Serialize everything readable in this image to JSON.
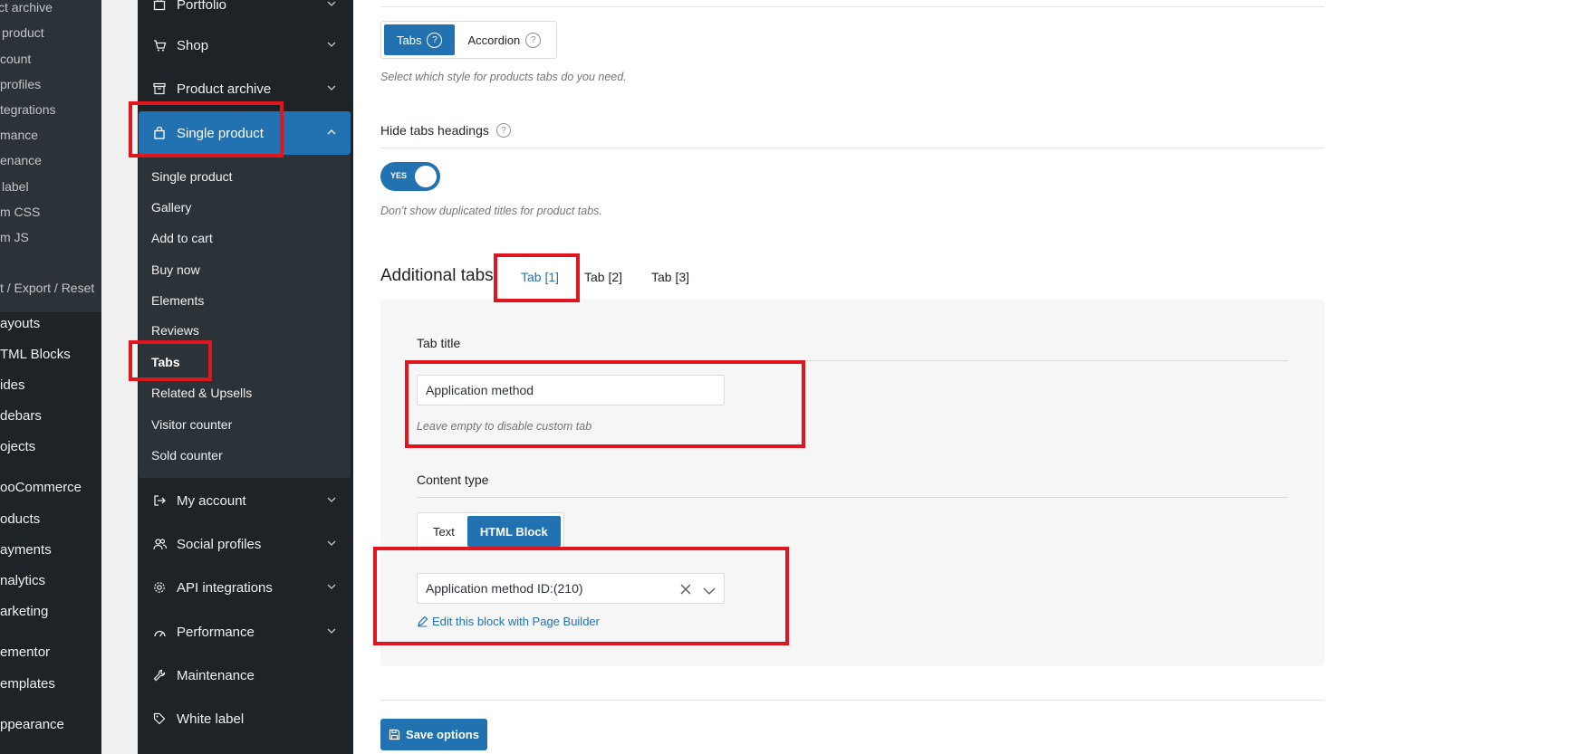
{
  "wp_menu": {
    "sub_items": [
      "ct archive",
      "product",
      "count",
      "profiles",
      "tegrations",
      "mance",
      "enance",
      "label",
      "m CSS",
      "m JS"
    ],
    "import_export": "t / Export / Reset",
    "top_items": [
      "ayouts",
      "TML Blocks",
      "ides",
      "debars",
      "ojects",
      "ooCommerce",
      "oducts",
      "ayments",
      "nalytics",
      "arketing",
      "ementor",
      "emplates",
      "ppearance"
    ]
  },
  "panel_sidebar": {
    "items_before": [
      {
        "label": "Portfolio",
        "icon": "portfolio-icon"
      },
      {
        "label": "Shop",
        "icon": "cart-icon"
      },
      {
        "label": "Product archive",
        "icon": "archive-icon"
      }
    ],
    "active": {
      "label": "Single product",
      "icon": "bag-icon"
    },
    "subitems": [
      "Single product",
      "Gallery",
      "Add to cart",
      "Buy now",
      "Elements",
      "Reviews",
      "Tabs",
      "Related & Upsells",
      "Visitor counter",
      "Sold counter"
    ],
    "current_subitem": "Tabs",
    "items_after": [
      {
        "label": "My account",
        "icon": "login-icon"
      },
      {
        "label": "Social profiles",
        "icon": "users-icon"
      },
      {
        "label": "API integrations",
        "icon": "gear-icon"
      },
      {
        "label": "Performance",
        "icon": "gauge-icon"
      },
      {
        "label": "Maintenance",
        "icon": "wrench-icon"
      },
      {
        "label": "White label",
        "icon": "tag-icon"
      }
    ]
  },
  "tabs_style": {
    "options": [
      "Tabs",
      "Accordion"
    ],
    "selected": "Tabs",
    "hint": "Select which style for products tabs do you need."
  },
  "hide_headings": {
    "label": "Hide tabs headings",
    "toggle_text": "YES",
    "hint": "Don't show duplicated titles for product tabs."
  },
  "additional_tabs": {
    "heading": "Additional tabs",
    "tabs": [
      "Tab [1]",
      "Tab [2]",
      "Tab [3]"
    ],
    "active_tab": "Tab [1]",
    "tab_title_label": "Tab title",
    "tab_title_value": "Application method",
    "tab_title_hint": "Leave empty to disable custom tab",
    "content_type_label": "Content type",
    "content_types": [
      "Text",
      "HTML Block"
    ],
    "content_type_selected": "HTML Block",
    "html_block_value": "Application method ID:(210)",
    "edit_link": "Edit this block with Page Builder"
  },
  "save_button": "Save options",
  "colors": {
    "accent": "#2271b1",
    "highlight": "#e0161e",
    "sidebar": "#1d2327"
  }
}
